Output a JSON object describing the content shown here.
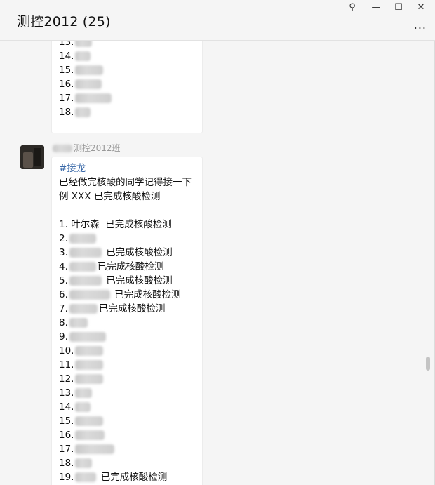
{
  "window": {
    "title": "测控2012 (25)",
    "controls": {
      "pin": "⚲",
      "minimize": "—",
      "maximize": "☐",
      "close": "✕"
    },
    "more": "..."
  },
  "messages": [
    {
      "lines": [
        "13.",
        "14.",
        "15.",
        "16.",
        "17.",
        "18."
      ]
    },
    {
      "sender": "测控2012班",
      "hashtag": "#接龙",
      "intro_line1": "已经做完核酸的同学记得接一下",
      "intro_line2": "例 XXX  已完成核酸检测",
      "entries": [
        {
          "num": "1.",
          "name": "叶尔森",
          "status": "已完成核酸检测"
        },
        {
          "num": "2.",
          "status": ""
        },
        {
          "num": "3.",
          "status": "已完成核酸检测"
        },
        {
          "num": "4.",
          "status": "已完成核酸检测"
        },
        {
          "num": "5.",
          "status": "已完成核酸检测"
        },
        {
          "num": "6.",
          "status": "已完成核酸检测"
        },
        {
          "num": "7.",
          "status": "已完成核酸检测"
        },
        {
          "num": "8.",
          "status": ""
        },
        {
          "num": "9.",
          "status": ""
        },
        {
          "num": "10.",
          "status": ""
        },
        {
          "num": "11.",
          "status": ""
        },
        {
          "num": "12.",
          "status": ""
        },
        {
          "num": "13.",
          "status": ""
        },
        {
          "num": "14.",
          "status": ""
        },
        {
          "num": "15.",
          "status": ""
        },
        {
          "num": "16.",
          "status": ""
        },
        {
          "num": "17.",
          "status": ""
        },
        {
          "num": "18.",
          "status": ""
        },
        {
          "num": "19.",
          "status": "已完成核酸检测"
        }
      ]
    }
  ]
}
